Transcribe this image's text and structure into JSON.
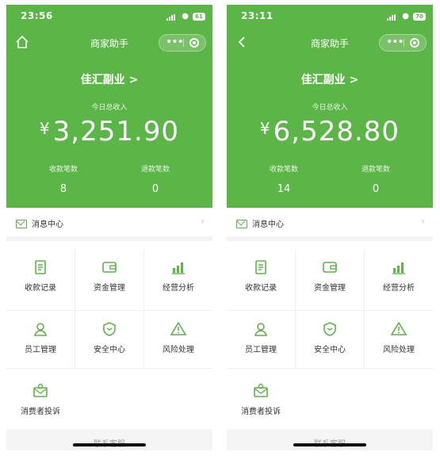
{
  "screens": [
    {
      "status": {
        "time": "23:56",
        "battery": "61"
      },
      "nav": {
        "title": "商家助手",
        "left": "home"
      },
      "store_name": "佳汇副业 >",
      "today_label": "今日总收入",
      "currency": "¥",
      "amount": "3,251.90",
      "stats": [
        {
          "label": "收款笔数",
          "value": "8"
        },
        {
          "label": "退款笔数",
          "value": "0"
        }
      ],
      "message_center": "消息中心",
      "menu": [
        {
          "label": "收款记录",
          "icon": "receipt-icon"
        },
        {
          "label": "资金管理",
          "icon": "wallet-icon"
        },
        {
          "label": "经营分析",
          "icon": "bar-chart-icon"
        },
        {
          "label": "员工管理",
          "icon": "person-icon"
        },
        {
          "label": "安全中心",
          "icon": "shield-icon"
        },
        {
          "label": "风险处理",
          "icon": "warning-icon"
        },
        {
          "label": "消费者投诉",
          "icon": "complaint-icon"
        }
      ],
      "footer": "联系客服"
    },
    {
      "status": {
        "time": "23:11",
        "battery": "70"
      },
      "nav": {
        "title": "商家助手",
        "left": "back"
      },
      "store_name": "佳汇副业 >",
      "today_label": "今日总收入",
      "currency": "¥",
      "amount": "6,528.80",
      "stats": [
        {
          "label": "收款笔数",
          "value": "14"
        },
        {
          "label": "退款笔数",
          "value": "0"
        }
      ],
      "message_center": "消息中心",
      "menu": [
        {
          "label": "收款记录",
          "icon": "receipt-icon"
        },
        {
          "label": "资金管理",
          "icon": "wallet-icon"
        },
        {
          "label": "经营分析",
          "icon": "bar-chart-icon"
        },
        {
          "label": "员工管理",
          "icon": "person-icon"
        },
        {
          "label": "安全中心",
          "icon": "shield-icon"
        },
        {
          "label": "风险处理",
          "icon": "warning-icon"
        },
        {
          "label": "消费者投诉",
          "icon": "complaint-icon"
        }
      ],
      "footer": "联系客服"
    }
  ],
  "colors": {
    "brand_green": "#5cb547",
    "text": "#333333"
  }
}
